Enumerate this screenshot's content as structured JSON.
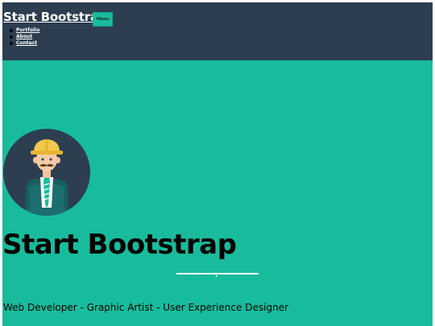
{
  "navbar": {
    "brand": "Start Bootstrap",
    "menu_button": "Menu",
    "links": [
      "Portfolio",
      "About",
      "Contact"
    ]
  },
  "hero": {
    "title": "Start Bootstrap",
    "subtitle": "Web Developer - Graphic Artist - User Experience Designer",
    "avatar_icon": "avatar-icon",
    "divider_icon": "star-icon"
  },
  "colors": {
    "navbar_bg": "#2c3e50",
    "hero_bg": "#18bc9c",
    "white": "#ffffff"
  }
}
